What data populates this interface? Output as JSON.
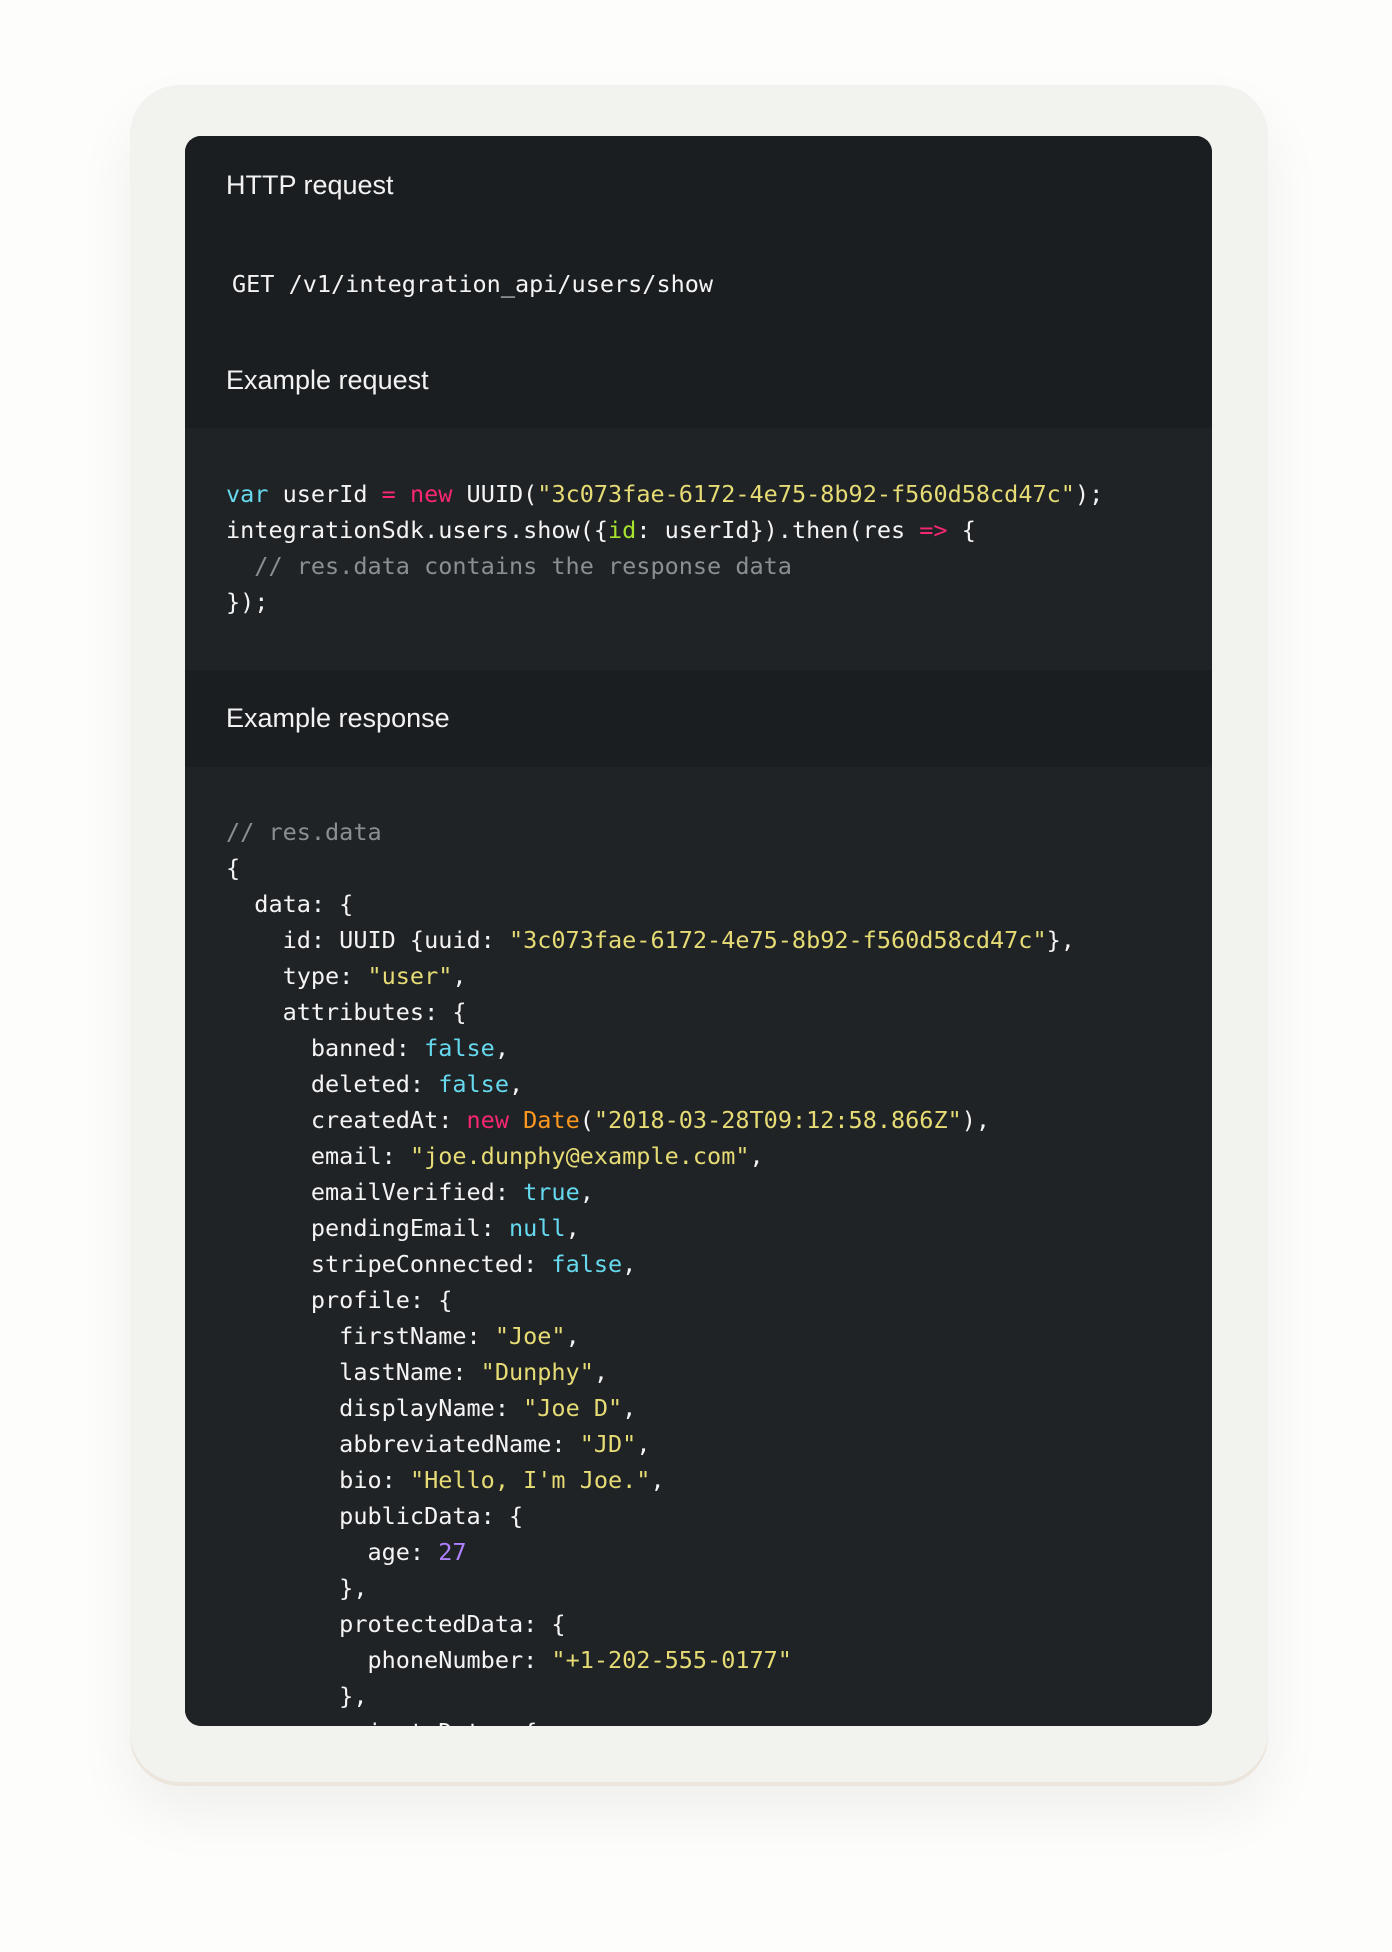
{
  "sections": {
    "http_request": {
      "title": "HTTP request",
      "endpoint": "GET /v1/integration_api/users/show"
    },
    "example_request": {
      "title": "Example request",
      "lines": [
        [
          [
            "kw",
            "var"
          ],
          [
            "t",
            " userId "
          ],
          [
            "op",
            "="
          ],
          [
            "t",
            " "
          ],
          [
            "op",
            "new"
          ],
          [
            "t",
            " UUID("
          ],
          [
            "str",
            "\"3c073fae-6172-4e75-8b92-f560d58cd47c\""
          ],
          [
            "t",
            ");"
          ]
        ],
        [
          [
            "t",
            "integrationSdk.users.show({"
          ],
          [
            "prop",
            "id"
          ],
          [
            "t",
            ": userId}).then(res "
          ],
          [
            "op",
            "=>"
          ],
          [
            "t",
            " {"
          ]
        ],
        [
          [
            "com",
            "  // res.data contains the response data"
          ]
        ],
        [
          [
            "t",
            "});"
          ]
        ]
      ]
    },
    "example_response": {
      "title": "Example response",
      "lines": [
        [
          [
            "com",
            "// res.data"
          ]
        ],
        [
          [
            "t",
            "{"
          ]
        ],
        [
          [
            "t",
            "  data: {"
          ]
        ],
        [
          [
            "t",
            "    id: UUID {uuid: "
          ],
          [
            "str",
            "\"3c073fae-6172-4e75-8b92-f560d58cd47c\""
          ],
          [
            "t",
            "},"
          ]
        ],
        [
          [
            "t",
            "    type: "
          ],
          [
            "str",
            "\"user\""
          ],
          [
            "t",
            ","
          ]
        ],
        [
          [
            "t",
            "    attributes: {"
          ]
        ],
        [
          [
            "t",
            "      banned: "
          ],
          [
            "bool",
            "false"
          ],
          [
            "t",
            ","
          ]
        ],
        [
          [
            "t",
            "      deleted: "
          ],
          [
            "bool",
            "false"
          ],
          [
            "t",
            ","
          ]
        ],
        [
          [
            "t",
            "      createdAt: "
          ],
          [
            "op",
            "new"
          ],
          [
            "t",
            " "
          ],
          [
            "cls",
            "Date"
          ],
          [
            "t",
            "("
          ],
          [
            "str",
            "\"2018-03-28T09:12:58.866Z\""
          ],
          [
            "t",
            "),"
          ]
        ],
        [
          [
            "t",
            "      email: "
          ],
          [
            "str",
            "\"joe.dunphy@example.com\""
          ],
          [
            "t",
            ","
          ]
        ],
        [
          [
            "t",
            "      emailVerified: "
          ],
          [
            "bool",
            "true"
          ],
          [
            "t",
            ","
          ]
        ],
        [
          [
            "t",
            "      pendingEmail: "
          ],
          [
            "bool",
            "null"
          ],
          [
            "t",
            ","
          ]
        ],
        [
          [
            "t",
            "      stripeConnected: "
          ],
          [
            "bool",
            "false"
          ],
          [
            "t",
            ","
          ]
        ],
        [
          [
            "t",
            "      profile: {"
          ]
        ],
        [
          [
            "t",
            "        firstName: "
          ],
          [
            "str",
            "\"Joe\""
          ],
          [
            "t",
            ","
          ]
        ],
        [
          [
            "t",
            "        lastName: "
          ],
          [
            "str",
            "\"Dunphy\""
          ],
          [
            "t",
            ","
          ]
        ],
        [
          [
            "t",
            "        displayName: "
          ],
          [
            "str",
            "\"Joe D\""
          ],
          [
            "t",
            ","
          ]
        ],
        [
          [
            "t",
            "        abbreviatedName: "
          ],
          [
            "str",
            "\"JD\""
          ],
          [
            "t",
            ","
          ]
        ],
        [
          [
            "t",
            "        bio: "
          ],
          [
            "str",
            "\"Hello, I'm Joe.\""
          ],
          [
            "t",
            ","
          ]
        ],
        [
          [
            "t",
            "        publicData: {"
          ]
        ],
        [
          [
            "t",
            "          age: "
          ],
          [
            "num",
            "27"
          ]
        ],
        [
          [
            "t",
            "        },"
          ]
        ],
        [
          [
            "t",
            "        protectedData: {"
          ]
        ],
        [
          [
            "t",
            "          phoneNumber: "
          ],
          [
            "str",
            "\"+1-202-555-0177\""
          ]
        ],
        [
          [
            "t",
            "        },"
          ]
        ],
        [
          [
            "t",
            "        privateData: {"
          ]
        ]
      ]
    }
  },
  "colors": {
    "panel": "#1a1e21",
    "code_bg": "#1f2326",
    "keyword": "#66d9ef",
    "operator": "#f92672",
    "string": "#e6db74",
    "number": "#ae81ff",
    "comment": "#8b8f92"
  }
}
